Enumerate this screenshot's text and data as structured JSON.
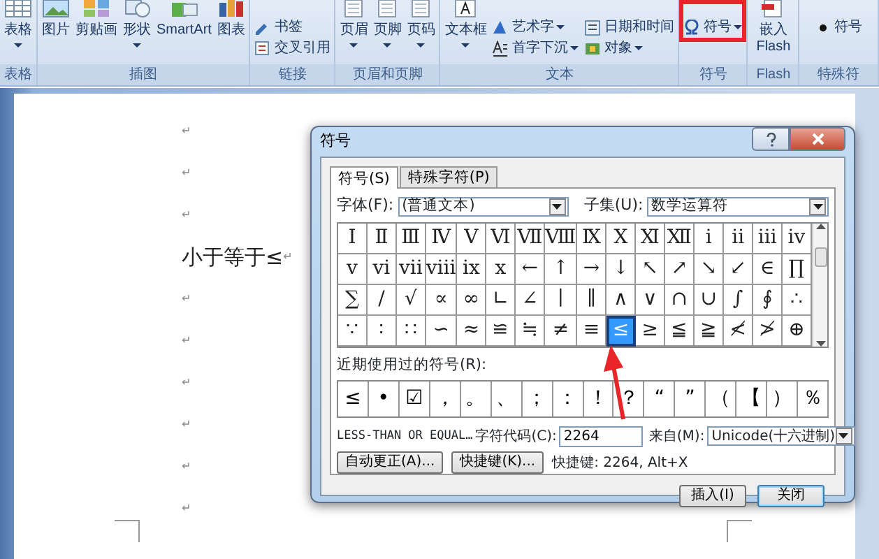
{
  "ribbon": {
    "groups": [
      {
        "label": "表格",
        "highlighted": false,
        "items": [
          {
            "label": "表格",
            "kind": "large",
            "dropdown": true
          }
        ]
      },
      {
        "label": "插图",
        "highlighted": false,
        "items": [
          {
            "label": "图片",
            "kind": "large",
            "dropdown": false
          },
          {
            "label": "剪贴画",
            "kind": "large",
            "dropdown": false
          },
          {
            "label": "形状",
            "kind": "large",
            "dropdown": true
          },
          {
            "label": "SmartArt",
            "kind": "large",
            "dropdown": false
          },
          {
            "label": "图表",
            "kind": "large",
            "dropdown": false
          }
        ]
      },
      {
        "label": "链接",
        "highlighted": false,
        "items": [
          {
            "label": "书签",
            "kind": "small",
            "dropdown": false
          },
          {
            "label": "交叉引用",
            "kind": "small",
            "dropdown": false
          }
        ]
      },
      {
        "label": "页眉和页脚",
        "highlighted": false,
        "items": [
          {
            "label": "页眉",
            "kind": "large",
            "dropdown": true
          },
          {
            "label": "页脚",
            "kind": "large",
            "dropdown": true
          },
          {
            "label": "页码",
            "kind": "large",
            "dropdown": true
          }
        ]
      },
      {
        "label": "文本",
        "highlighted": false,
        "items": [
          {
            "label": "文本框",
            "kind": "large",
            "dropdown": true
          },
          {
            "label": "艺术字",
            "kind": "small",
            "dropdown": true
          },
          {
            "label": "首字下沉",
            "kind": "small",
            "dropdown": true
          },
          {
            "label": "日期和时间",
            "kind": "small",
            "dropdown": false
          },
          {
            "label": "对象",
            "kind": "small",
            "dropdown": true
          }
        ]
      },
      {
        "label": "符号",
        "highlighted": true,
        "items": [
          {
            "label": "符号",
            "kind": "small",
            "dropdown": true
          }
        ]
      },
      {
        "label": "Flash",
        "highlighted": false,
        "items": [
          {
            "label": "嵌入 Flash",
            "kind": "large",
            "dropdown": false
          }
        ]
      },
      {
        "label": "特殊符",
        "highlighted": false,
        "items": [
          {
            "label": "符号",
            "kind": "small",
            "dropdown": false
          }
        ]
      }
    ]
  },
  "document": {
    "paragraphs": [
      {
        "mark": "↵"
      },
      {
        "mark": "↵"
      },
      {
        "mark": "↵"
      },
      {
        "text": "小于等于≤",
        "mark": "↵"
      },
      {
        "mark": "↵"
      },
      {
        "mark": "↵"
      },
      {
        "mark": "↵"
      },
      {
        "mark": "↵"
      },
      {
        "mark": "↵"
      },
      {
        "mark": "↵"
      }
    ]
  },
  "dialog": {
    "title": "符号",
    "tabs": [
      {
        "label": "符号(S)",
        "selected": true
      },
      {
        "label": "特殊字符(P)",
        "selected": false
      }
    ],
    "font_label": "字体(F):",
    "font_value": "(普通文本)",
    "subset_label": "子集(U):",
    "subset_value": "数学运算符",
    "symbols": [
      {
        "char": "Ⅰ",
        "selected": false
      },
      {
        "char": "Ⅱ",
        "selected": false
      },
      {
        "char": "Ⅲ",
        "selected": false
      },
      {
        "char": "Ⅳ",
        "selected": false
      },
      {
        "char": "Ⅴ",
        "selected": false
      },
      {
        "char": "Ⅵ",
        "selected": false
      },
      {
        "char": "Ⅶ",
        "selected": false
      },
      {
        "char": "Ⅷ",
        "selected": false
      },
      {
        "char": "Ⅸ",
        "selected": false
      },
      {
        "char": "Ⅹ",
        "selected": false
      },
      {
        "char": "Ⅺ",
        "selected": false
      },
      {
        "char": "Ⅻ",
        "selected": false
      },
      {
        "char": "ⅰ",
        "selected": false
      },
      {
        "char": "ⅱ",
        "selected": false
      },
      {
        "char": "ⅲ",
        "selected": false
      },
      {
        "char": "ⅳ",
        "selected": false
      },
      {
        "char": "ⅴ",
        "selected": false
      },
      {
        "char": "ⅵ",
        "selected": false
      },
      {
        "char": "ⅶ",
        "selected": false
      },
      {
        "char": "ⅷ",
        "selected": false
      },
      {
        "char": "ⅸ",
        "selected": false
      },
      {
        "char": "ⅹ",
        "selected": false
      },
      {
        "char": "←",
        "selected": false
      },
      {
        "char": "↑",
        "selected": false
      },
      {
        "char": "→",
        "selected": false
      },
      {
        "char": "↓",
        "selected": false
      },
      {
        "char": "↖",
        "selected": false
      },
      {
        "char": "↗",
        "selected": false
      },
      {
        "char": "↘",
        "selected": false
      },
      {
        "char": "↙",
        "selected": false
      },
      {
        "char": "∈",
        "selected": false
      },
      {
        "char": "∏",
        "selected": false
      },
      {
        "char": "∑",
        "selected": false
      },
      {
        "char": "∕",
        "selected": false
      },
      {
        "char": "√",
        "selected": false
      },
      {
        "char": "∝",
        "selected": false
      },
      {
        "char": "∞",
        "selected": false
      },
      {
        "char": "∟",
        "selected": false
      },
      {
        "char": "∠",
        "selected": false
      },
      {
        "char": "∣",
        "selected": false
      },
      {
        "char": "∥",
        "selected": false
      },
      {
        "char": "∧",
        "selected": false
      },
      {
        "char": "∨",
        "selected": false
      },
      {
        "char": "∩",
        "selected": false
      },
      {
        "char": "∪",
        "selected": false
      },
      {
        "char": "∫",
        "selected": false
      },
      {
        "char": "∮",
        "selected": false
      },
      {
        "char": "∴",
        "selected": false
      },
      {
        "char": "∵",
        "selected": false
      },
      {
        "char": "∶",
        "selected": false
      },
      {
        "char": "∷",
        "selected": false
      },
      {
        "char": "∽",
        "selected": false
      },
      {
        "char": "≈",
        "selected": false
      },
      {
        "char": "≌",
        "selected": false
      },
      {
        "char": "≒",
        "selected": false
      },
      {
        "char": "≠",
        "selected": false
      },
      {
        "char": "≡",
        "selected": false
      },
      {
        "char": "≤",
        "selected": true
      },
      {
        "char": "≥",
        "selected": false
      },
      {
        "char": "≦",
        "selected": false
      },
      {
        "char": "≧",
        "selected": false
      },
      {
        "char": "≮",
        "selected": false
      },
      {
        "char": "≯",
        "selected": false
      },
      {
        "char": "⊕",
        "selected": false
      }
    ],
    "recent_label": "近期使用过的符号(R):",
    "recent": [
      "≤",
      "•",
      "☑",
      "，",
      "。",
      "、",
      "；",
      "：",
      "！",
      "？",
      "“",
      "”",
      "（",
      "【",
      "）",
      "％"
    ],
    "char_name": "LESS-THAN OR EQUAL…",
    "code_label": "字符代码(C):",
    "code_value": "2264",
    "from_label": "来自(M):",
    "from_value": "Unicode(十六进制)",
    "autocorrect_button": "自动更正(A)...",
    "shortcut_button": "快捷键(K)...",
    "shortcut_info": "快捷键: 2264, Alt+X",
    "insert_button": "插入(I)",
    "close_button": "关闭"
  }
}
